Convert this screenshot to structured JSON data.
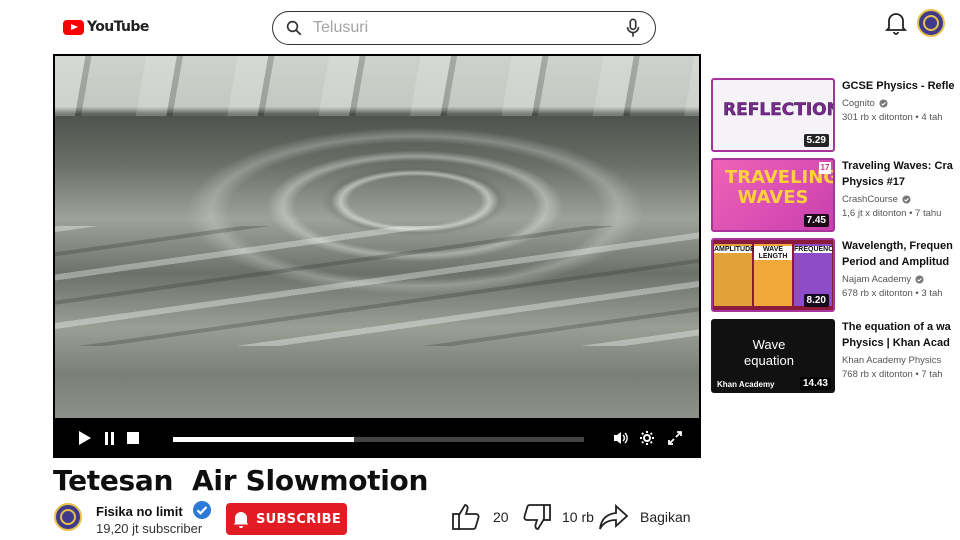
{
  "header": {
    "logo_text": "YouTube",
    "search_placeholder": "Telusuri"
  },
  "player": {
    "progress_fraction": 0.44
  },
  "video": {
    "title": "Tetesan  Air Slowmotion",
    "channel_name": "Fisika no limit",
    "subscriber_count": "19,20 jt subscriber",
    "subscribe_label": "SUBSCRIBE",
    "like_count": "20",
    "dislike_count": "10 rb",
    "share_label": "Bagikan"
  },
  "recommendations": [
    {
      "title": "GCSE Physics - Refle",
      "channel": "Cognito",
      "meta": "301 rb x ditonton  •  4 tah",
      "duration": "5.29",
      "thumb_text": "REFLECTIONS"
    },
    {
      "title": "Traveling Waves: Cra\nPhysics #17",
      "channel": "CrashCourse",
      "meta": "1,6 jt x ditonton  •  7 tahu",
      "duration": "7.45",
      "thumb_text": "TRAVELING WAVES",
      "thumb_badge": "17"
    },
    {
      "title": "Wavelength, Frequen\nPeriod and Amplitud",
      "channel": "Najam Academy",
      "meta": "678 rb x ditonton  •  3 tah",
      "duration": "8.20",
      "thumb_panels": [
        "AMPLITUDE",
        "WAVE LENGTH",
        "FREQUENCY"
      ]
    },
    {
      "title": "The equation of a wa\nPhysics | Khan Acad",
      "channel": "Khan Academy Physics",
      "meta": "768 rb x ditonton  •  7 tah",
      "duration": "14.43",
      "thumb_text": "Wave equation",
      "thumb_brand": "Khan Academy"
    }
  ],
  "colors": {
    "subscribe": "#e31b23",
    "brand_red": "#ff0000",
    "verified": "#3ea6ff"
  }
}
